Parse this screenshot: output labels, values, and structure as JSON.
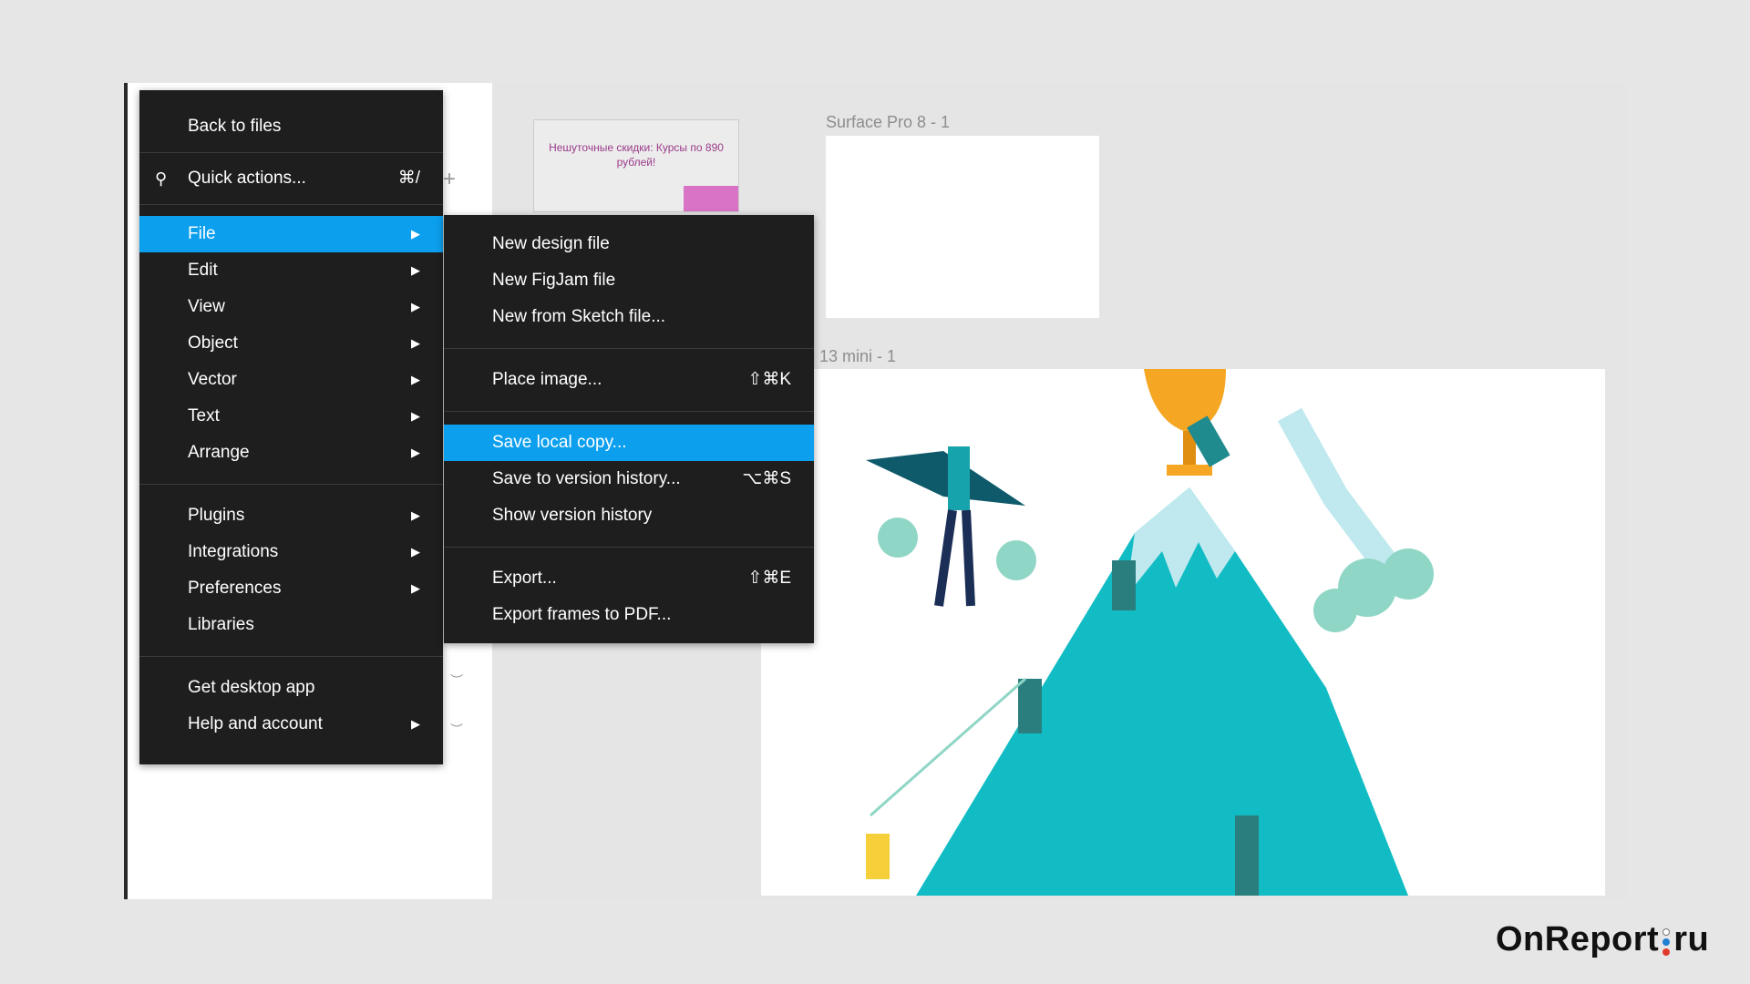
{
  "main_menu": {
    "back": "Back to files",
    "quick_actions": {
      "label": "Quick actions...",
      "shortcut": "⌘/"
    },
    "items": [
      {
        "label": "File",
        "submenu": true,
        "highlighted": true
      },
      {
        "label": "Edit",
        "submenu": true
      },
      {
        "label": "View",
        "submenu": true
      },
      {
        "label": "Object",
        "submenu": true
      },
      {
        "label": "Vector",
        "submenu": true
      },
      {
        "label": "Text",
        "submenu": true
      },
      {
        "label": "Arrange",
        "submenu": true
      },
      {
        "label": "Plugins",
        "submenu": true
      },
      {
        "label": "Integrations",
        "submenu": true
      },
      {
        "label": "Preferences",
        "submenu": true
      },
      {
        "label": "Libraries",
        "submenu": false
      },
      {
        "label": "Get desktop app",
        "submenu": false
      },
      {
        "label": "Help and account",
        "submenu": true
      }
    ],
    "arrow": "▶"
  },
  "file_submenu": [
    {
      "label": "New design file"
    },
    {
      "label": "New FigJam file"
    },
    {
      "label": "New from Sketch file..."
    },
    {
      "label": "Place image...",
      "shortcut": "⇧⌘K"
    },
    {
      "label": "Save local copy...",
      "highlighted": true
    },
    {
      "label": "Save to version history...",
      "shortcut": "⌥⌘S"
    },
    {
      "label": "Show version history"
    },
    {
      "label": "Export...",
      "shortcut": "⇧⌘E"
    },
    {
      "label": "Export frames to PDF..."
    }
  ],
  "canvas": {
    "thumb_text": "Нешуточные скидки: Курсы по 890 рублей!",
    "frame1_label": "Surface Pro 8 - 1",
    "frame2_label": "13 mini - 1"
  },
  "watermark": {
    "brand": "OnReport",
    "tld": "ru"
  },
  "colors": {
    "accent": "#0b9fee",
    "menu_bg": "#1e1e1e",
    "mountain": "#12bcc4",
    "trophy": "#f5a623"
  }
}
